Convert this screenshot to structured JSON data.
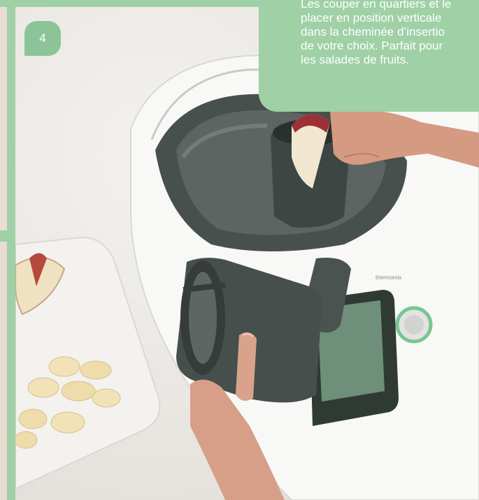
{
  "step": {
    "number": "4"
  },
  "instruction": {
    "lines": [
      "Les couper en quartiers et le",
      "placer en position verticale",
      "dans la cheminée d’insertio",
      "de votre choix. Parfait pour",
      "les salades de fruits."
    ]
  },
  "device": {
    "brand_text": "thermomix"
  },
  "colors": {
    "accent": "#9fd0a6",
    "badge": "#8cc497",
    "text_on_accent": "#ffffff"
  }
}
